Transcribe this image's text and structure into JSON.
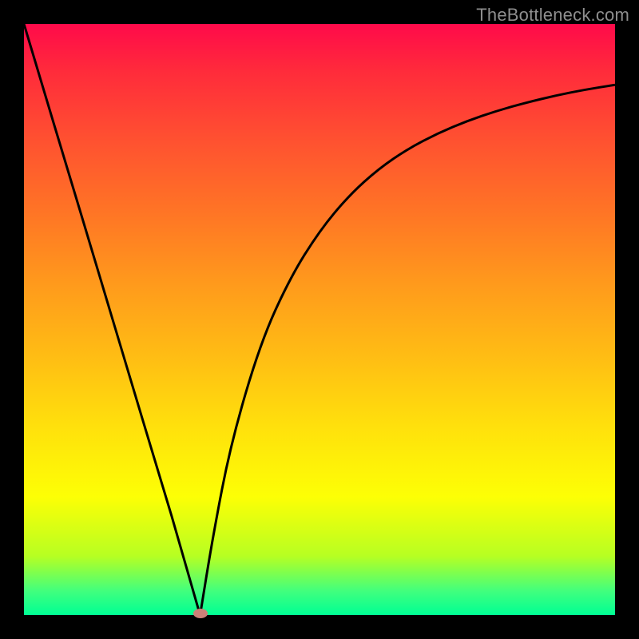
{
  "watermark": "TheBottleneck.com",
  "chart_data": {
    "type": "line",
    "title": "",
    "xlabel": "",
    "ylabel": "",
    "xlim": [
      0,
      1
    ],
    "ylim": [
      0,
      1
    ],
    "series": [
      {
        "name": "left-branch",
        "x": [
          0.0,
          0.05,
          0.1,
          0.15,
          0.2,
          0.25,
          0.298
        ],
        "values": [
          1.0,
          0.833,
          0.667,
          0.5,
          0.333,
          0.167,
          0.0
        ]
      },
      {
        "name": "right-branch",
        "x": [
          0.298,
          0.32,
          0.35,
          0.4,
          0.45,
          0.5,
          0.55,
          0.6,
          0.65,
          0.7,
          0.75,
          0.8,
          0.85,
          0.9,
          0.95,
          1.0
        ],
        "values": [
          0.0,
          0.135,
          0.29,
          0.46,
          0.57,
          0.65,
          0.71,
          0.755,
          0.789,
          0.815,
          0.836,
          0.853,
          0.867,
          0.879,
          0.889,
          0.897
        ]
      }
    ],
    "marker": {
      "x": 0.298,
      "y": 0.003
    },
    "background_gradient": {
      "top": "#ff0a4a",
      "mid": "#ffe00c",
      "bottom": "#00ff94"
    }
  }
}
